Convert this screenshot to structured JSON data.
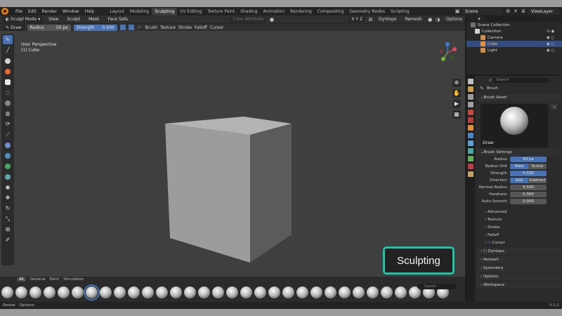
{
  "topbar": {
    "menu": [
      "File",
      "Edit",
      "Render",
      "Window",
      "Help"
    ],
    "workspaces": [
      "Layout",
      "Modeling",
      "Sculpting",
      "UV Editing",
      "Texture Paint",
      "Shading",
      "Animation",
      "Rendering",
      "Compositing",
      "Geometry Nodes",
      "Scripting"
    ],
    "active_workspace": "Sculpting",
    "scene": "Scene",
    "view_layer": "ViewLayer"
  },
  "header": {
    "mode": "Sculpt Mode",
    "menus": [
      "View",
      "Sculpt",
      "Mask",
      "Face Sets"
    ],
    "color_attribute": "Color Attribute",
    "symmetry": "X Y Z",
    "dyntopo": "Dyntopo",
    "remesh": "Remesh",
    "options": "Options"
  },
  "tool_settings": {
    "tool": "Draw",
    "radius_label": "Radius",
    "radius_value": "50 px",
    "strength_label": "Strength",
    "strength_value": "0.500",
    "menus": [
      "Brush",
      "Texture",
      "Stroke",
      "Falloff",
      "Cursor"
    ]
  },
  "viewport": {
    "perspective": "User Perspective",
    "object": "(1) Cube",
    "badge": "Sculpting"
  },
  "brush_shelf": {
    "tabs": [
      "All",
      "General",
      "Paint",
      "Simulation"
    ],
    "active_tab": "All",
    "search_placeholder": "Search"
  },
  "statusbar": {
    "items": [
      "Resize",
      "Options"
    ],
    "version": "4.3.2"
  },
  "outliner": {
    "search_placeholder": "",
    "rows": [
      "Scene Collection",
      "Collection",
      "Camera",
      "Cube",
      "Light"
    ]
  },
  "properties": {
    "search_placeholder": "Search",
    "brush_label": "Brush",
    "brush_asset_header": "Brush Asset",
    "brush_name": "Draw",
    "brush_settings_header": "Brush Settings",
    "radius_label": "Radius",
    "radius_value": "50 px",
    "radius_unit_label": "Radius Unit",
    "unit_view": "View",
    "unit_scene": "Scene",
    "strength_label": "Strength",
    "strength_value": "0.500",
    "direction_label": "Direction",
    "direction_add": "Add",
    "direction_subtract": "Subtract",
    "normal_radius_label": "Normal Radius",
    "normal_radius_value": "0.500",
    "hardness_label": "Hardness",
    "hardness_value": "0.000",
    "auto_smooth_label": "Auto-Smooth",
    "auto_smooth_value": "0.000",
    "subpanels": [
      "Advanced",
      "Texture",
      "Stroke",
      "Falloff",
      "Cursor"
    ],
    "sections": [
      "Dyntopo",
      "Remesh",
      "Symmetry",
      "Options",
      "Workspace"
    ]
  },
  "colors": {
    "accent_blue": "#4772b3",
    "badge_border": "#1fc3a6",
    "viewport_bg": "#3f3f3f"
  }
}
